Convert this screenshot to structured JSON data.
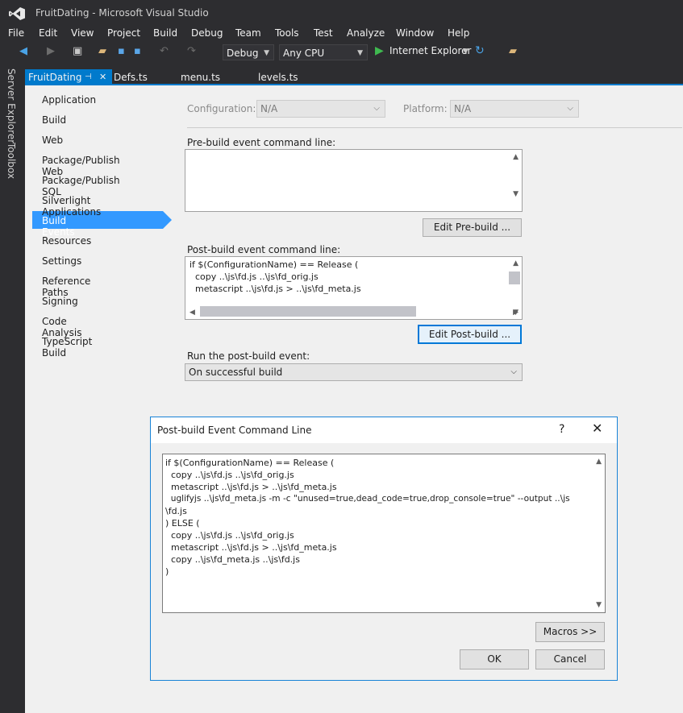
{
  "window": {
    "title": "FruitDating - Microsoft Visual Studio"
  },
  "menu": [
    {
      "label": "File"
    },
    {
      "label": "Edit"
    },
    {
      "label": "View"
    },
    {
      "label": "Project"
    },
    {
      "label": "Build"
    },
    {
      "label": "Debug"
    },
    {
      "label": "Team"
    },
    {
      "label": "Tools"
    },
    {
      "label": "Test"
    },
    {
      "label": "Analyze"
    },
    {
      "label": "Window"
    },
    {
      "label": "Help"
    }
  ],
  "toolbar": {
    "config": "Debug",
    "platform": "Any CPU",
    "run_target": "Internet Explorer"
  },
  "side_tabs": {
    "server_explorer": "Server Explorer",
    "toolbox": "Toolbox"
  },
  "doc_tabs": [
    {
      "label": "FruitDating",
      "active": true
    },
    {
      "label": "Defs.ts"
    },
    {
      "label": "menu.ts"
    },
    {
      "label": "levels.ts"
    }
  ],
  "nav": [
    {
      "label": "Application"
    },
    {
      "label": "Build"
    },
    {
      "label": "Web"
    },
    {
      "label": "Package/Publish Web"
    },
    {
      "label": "Package/Publish SQL"
    },
    {
      "label": "Silverlight Applications"
    },
    {
      "label": "Build Events",
      "selected": true
    },
    {
      "label": "Resources"
    },
    {
      "label": "Settings"
    },
    {
      "label": "Reference Paths"
    },
    {
      "label": "Signing"
    },
    {
      "label": "Code Analysis"
    },
    {
      "label": "TypeScript Build"
    }
  ],
  "form": {
    "configuration_label": "Configuration:",
    "configuration_value": "N/A",
    "platform_label": "Platform:",
    "platform_value": "N/A",
    "prebuild_label": "Pre-build event command line:",
    "prebuild_value": "",
    "edit_prebuild_button": "Edit Pre-build ...",
    "postbuild_label": "Post-build event command line:",
    "postbuild_lines": [
      "if $(ConfigurationName) == Release (",
      "  copy ..\\js\\fd.js ..\\js\\fd_orig.js",
      "  metascript ..\\js\\fd.js > ..\\js\\fd_meta.js"
    ],
    "edit_postbuild_button": "Edit Post-build ...",
    "run_label": "Run the post-build event:",
    "run_value": "On successful build"
  },
  "dialog": {
    "title": "Post-build Event Command Line",
    "help": "?",
    "close": "✕",
    "lines": [
      "if $(ConfigurationName) == Release (",
      "  copy ..\\js\\fd.js ..\\js\\fd_orig.js",
      "  metascript ..\\js\\fd.js > ..\\js\\fd_meta.js",
      "  uglifyjs ..\\js\\fd_meta.js -m -c \"unused=true,dead_code=true,drop_console=true\" --output ..\\js",
      "\\fd.js",
      ") ELSE (",
      "  copy ..\\js\\fd.js ..\\js\\fd_orig.js",
      "  metascript ..\\js\\fd.js > ..\\js\\fd_meta.js",
      "  copy ..\\js\\fd_meta.js ..\\js\\fd.js",
      ")"
    ],
    "macros_button": "Macros >>",
    "ok_button": "OK",
    "cancel_button": "Cancel"
  }
}
